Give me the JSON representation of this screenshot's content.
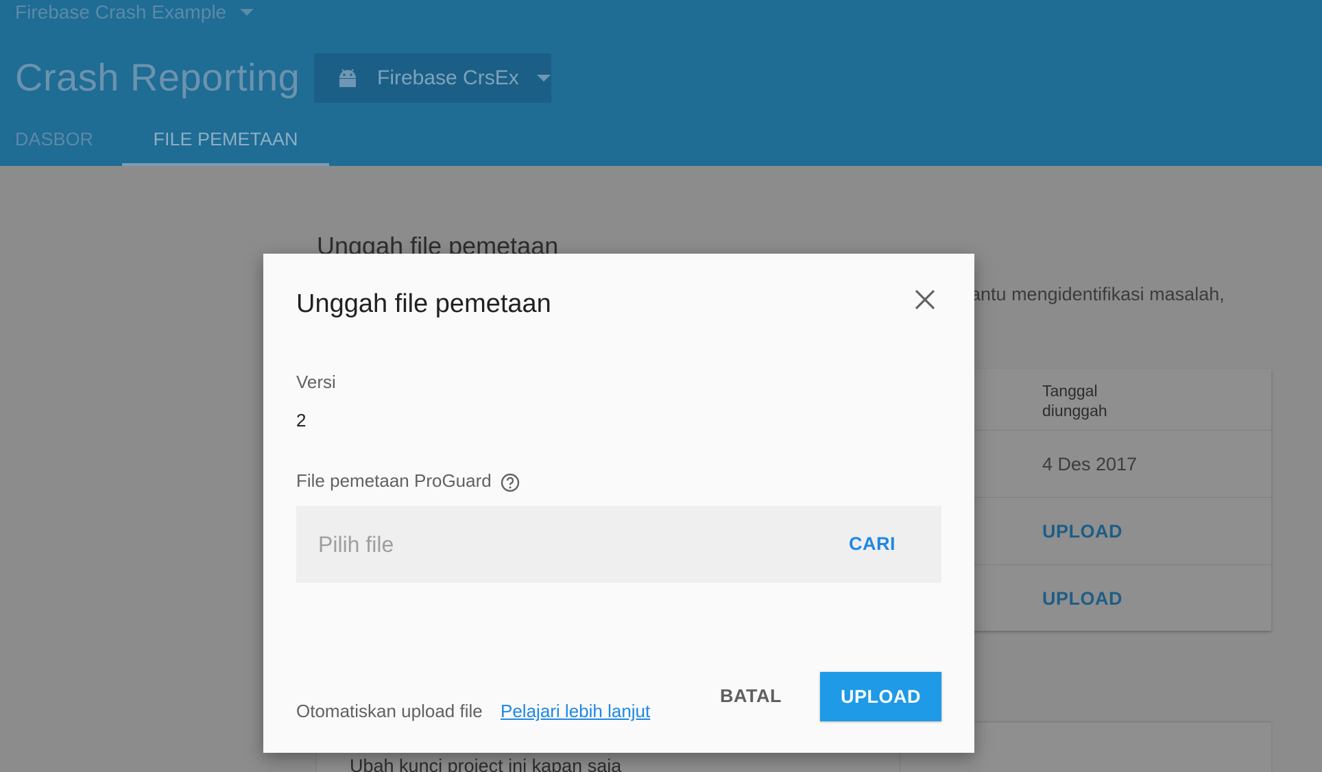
{
  "header": {
    "project_name": "Firebase Crash Example",
    "title": "Crash Reporting",
    "app_name": "Firebase CrsEx",
    "tabs": [
      {
        "label": "DASBOR"
      },
      {
        "label": "FILE PEMETAAN",
        "active": true
      }
    ]
  },
  "background": {
    "section_title": "Unggah file pemetaan",
    "description_fragment": "bantu mengidentifikasi masalah,",
    "table": {
      "column_header": "Tanggal diunggah",
      "rows": [
        {
          "value": "4 Des 2017"
        },
        {
          "value": "UPLOAD"
        },
        {
          "value": "UPLOAD"
        }
      ]
    },
    "card2_text": "Ubah kunci project ini kapan saja"
  },
  "modal": {
    "title": "Unggah file pemetaan",
    "version_label": "Versi",
    "version_value": "2",
    "mapping_label": "File pemetaan ProGuard",
    "file_placeholder": "Pilih file",
    "browse_label": "CARI",
    "automate_text": "Otomatiskan upload file",
    "learn_more": "Pelajari lebih lanjut",
    "cancel_label": "BATAL",
    "upload_label": "UPLOAD"
  },
  "icons": {
    "project_dropdown": "chevron-down-icon",
    "app_platform": "android-icon",
    "close": "close-icon",
    "help": "help-icon"
  },
  "colors": {
    "header_bg": "#1f6c94",
    "accent": "#1e9ae6",
    "overlay_bg": "#8c8c8c"
  }
}
